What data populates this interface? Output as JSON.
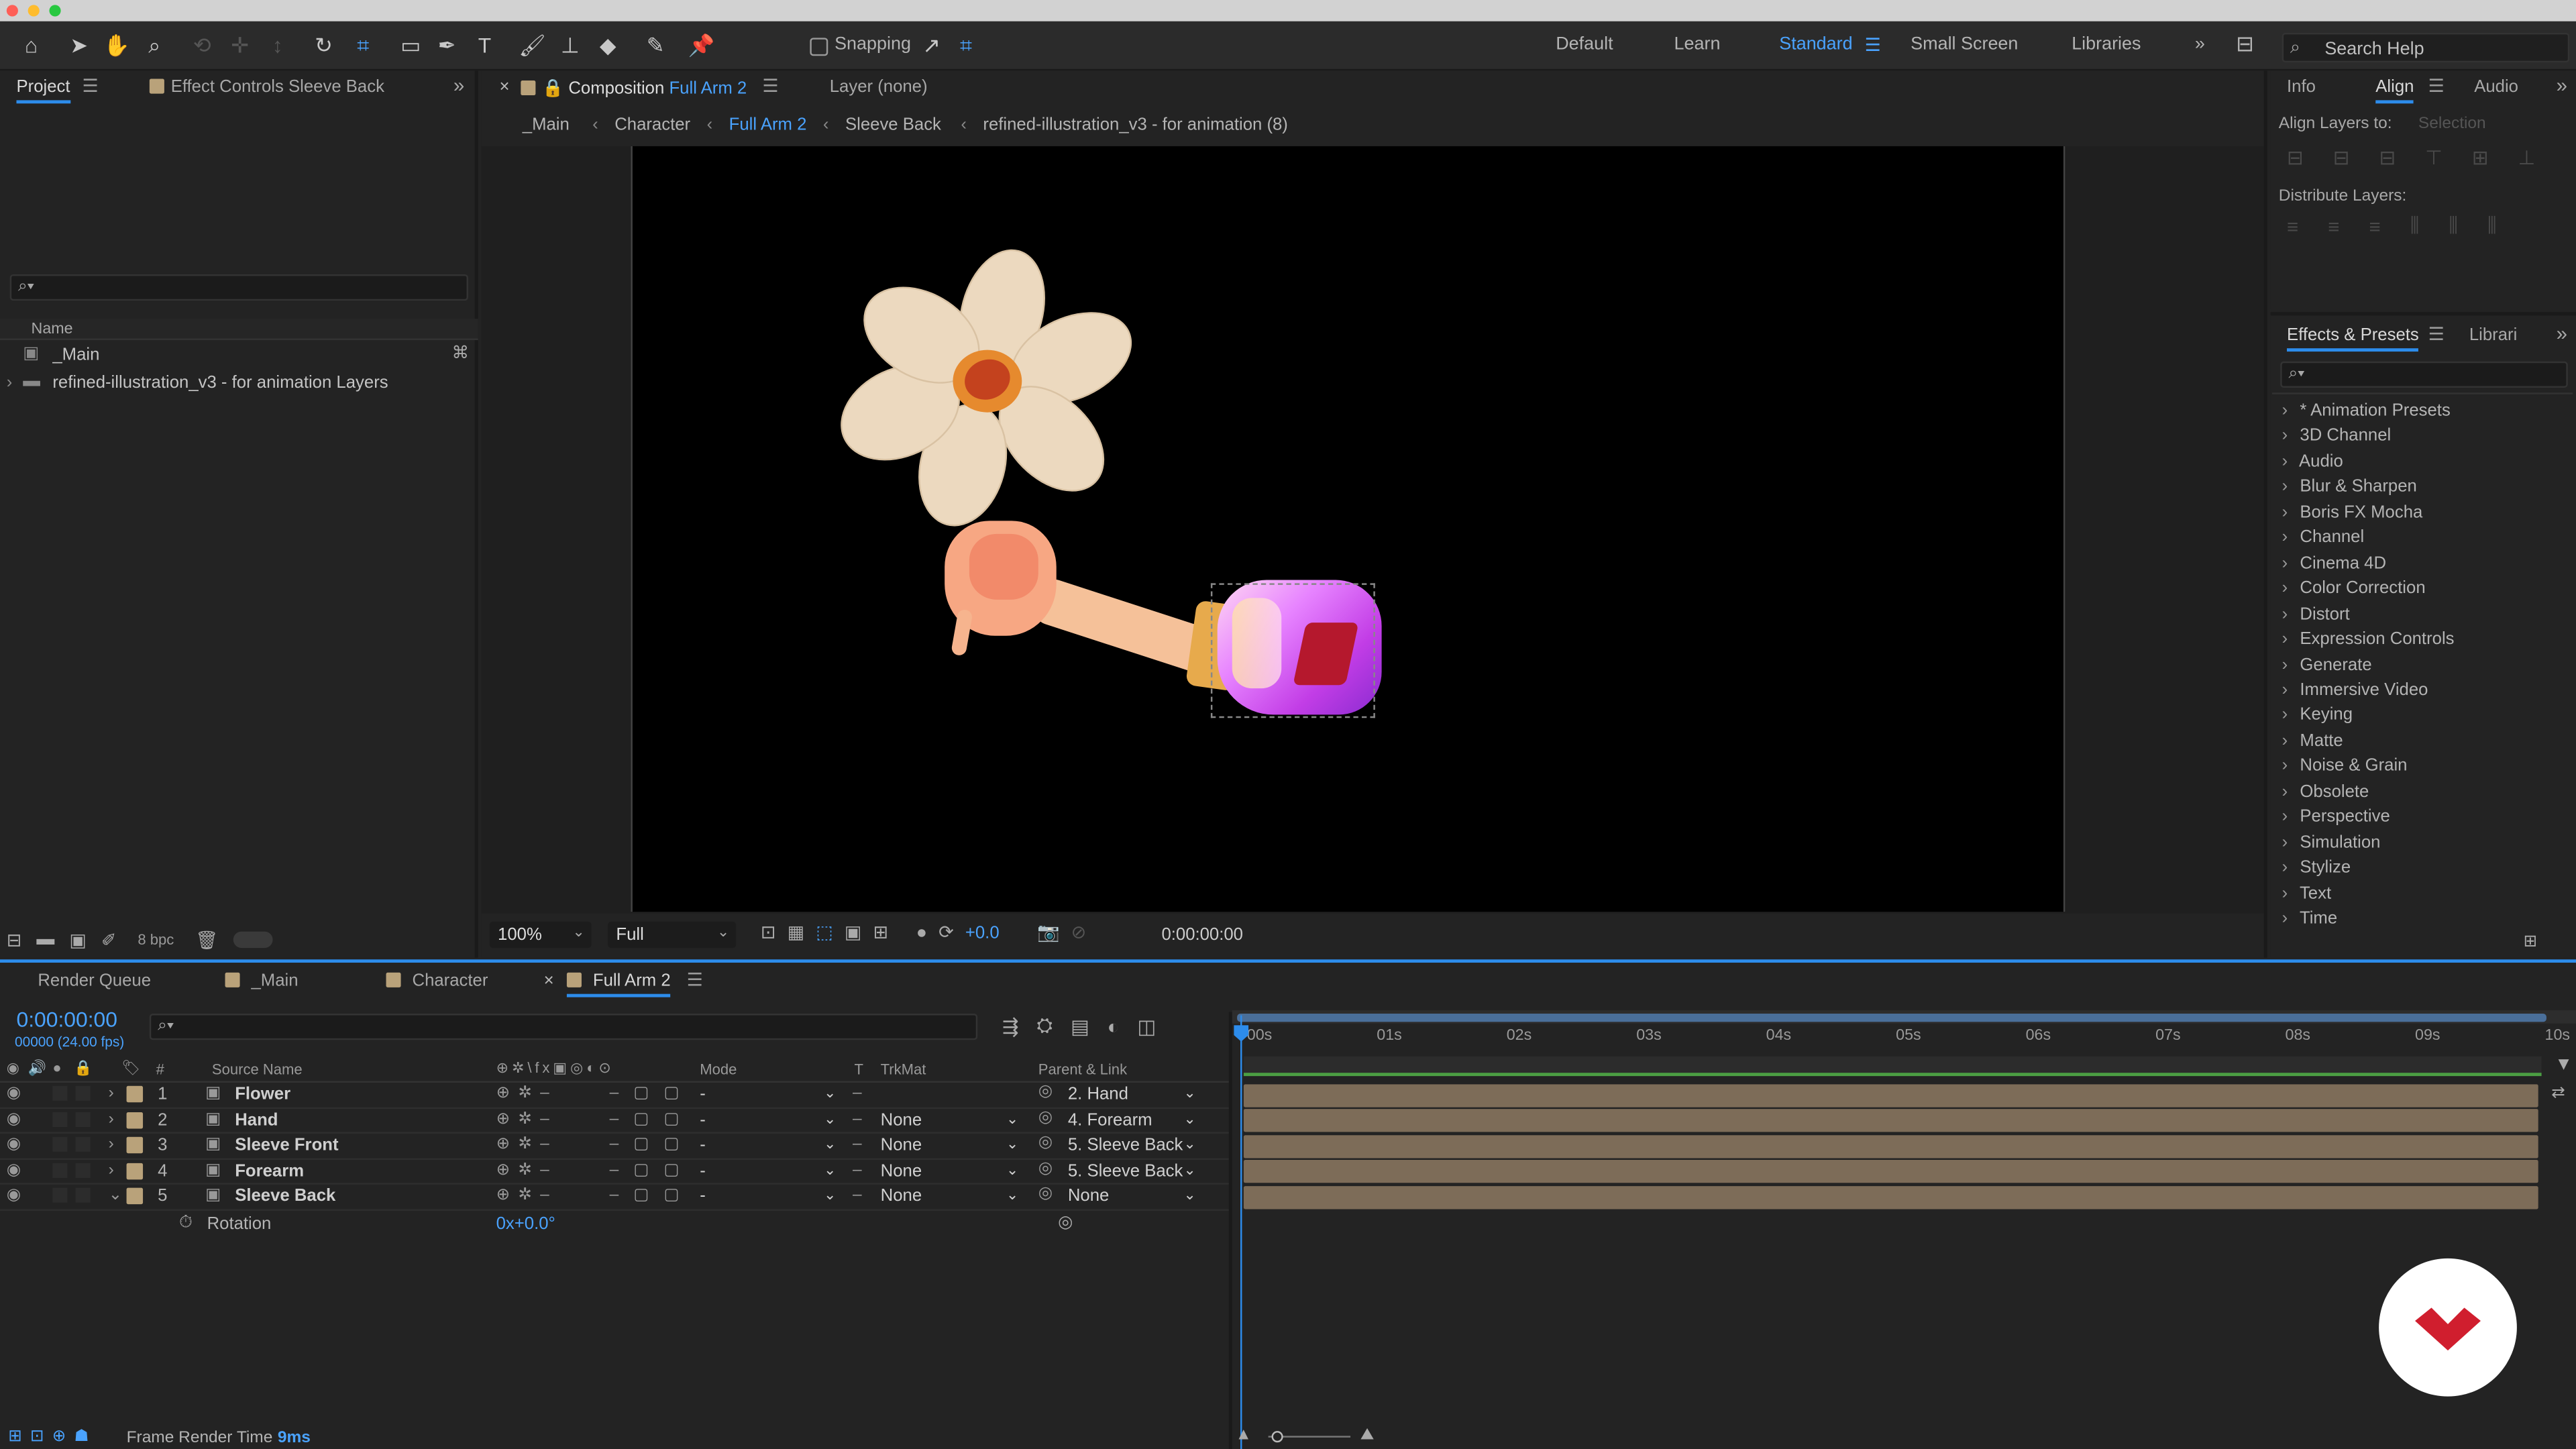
{
  "toolbar": {
    "snapping": "Snapping",
    "workspaces": [
      "Default",
      "Learn",
      "Standard",
      "Small Screen",
      "Libraries"
    ],
    "active_workspace": "Standard",
    "search_help": "Search Help"
  },
  "project": {
    "tab": "Project",
    "effect_controls_tab": "Effect Controls Sleeve Back",
    "col_name": "Name",
    "items": [
      "_Main",
      "refined-illustration_v3 - for animation Layers"
    ],
    "bpc": "8 bpc"
  },
  "comp": {
    "close": "×",
    "tab_prefix": "Composition",
    "tab_name": "Full Arm 2",
    "layer_tab": "Layer (none)",
    "breadcrumbs": [
      "_Main",
      "Character",
      "Full Arm 2",
      "Sleeve Back",
      "refined-illustration_v3 - for animation (8)"
    ],
    "zoom": "100%",
    "resolution": "Full",
    "exposure": "+0.0",
    "timecode": "0:00:00:00"
  },
  "right": {
    "tabs": [
      "Info",
      "Align",
      "Audio"
    ],
    "align_layers_to": "Align Layers to:",
    "selection": "Selection",
    "distribute": "Distribute Layers:",
    "effects_tab": "Effects & Presets",
    "libraries_tab": "Librari",
    "effects": [
      "* Animation Presets",
      "3D Channel",
      "Audio",
      "Blur & Sharpen",
      "Boris FX Mocha",
      "Channel",
      "Cinema 4D",
      "Color Correction",
      "Distort",
      "Expression Controls",
      "Generate",
      "Immersive Video",
      "Keying",
      "Matte",
      "Noise & Grain",
      "Obsolete",
      "Perspective",
      "Simulation",
      "Stylize",
      "Text",
      "Time"
    ]
  },
  "timeline": {
    "tabs": [
      "Render Queue",
      "_Main",
      "Character",
      "Full Arm 2"
    ],
    "timecode": "0:00:00:00",
    "fps": "00000 (24.00 fps)",
    "col_hash": "#",
    "col_source": "Source Name",
    "col_mode": "Mode",
    "col_t": "T",
    "col_trkmat": "TrkMat",
    "col_parent": "Parent & Link",
    "ruler": [
      "00s",
      "01s",
      "02s",
      "03s",
      "04s",
      "05s",
      "06s",
      "07s",
      "08s",
      "09s",
      "10s"
    ],
    "layers": [
      {
        "num": "1",
        "name": "Flower",
        "mode": "-",
        "trkmat": "",
        "parent": "2. Hand"
      },
      {
        "num": "2",
        "name": "Hand",
        "mode": "-",
        "trkmat": "None",
        "parent": "4. Forearm"
      },
      {
        "num": "3",
        "name": "Sleeve Front",
        "mode": "-",
        "trkmat": "None",
        "parent": "5. Sleeve Back"
      },
      {
        "num": "4",
        "name": "Forearm",
        "mode": "-",
        "trkmat": "None",
        "parent": "5. Sleeve Back"
      },
      {
        "num": "5",
        "name": "Sleeve Back",
        "mode": "-",
        "trkmat": "None",
        "parent": "None"
      }
    ],
    "property": {
      "name": "Rotation",
      "value": "0x+0.0°"
    },
    "status_label": "Frame Render Time",
    "status_value": "9ms"
  },
  "colors": {
    "accent": "#2d8ceb",
    "layer_label": "#b9a27a",
    "bar": "#7d6c58",
    "logo": "#d01e2e"
  }
}
